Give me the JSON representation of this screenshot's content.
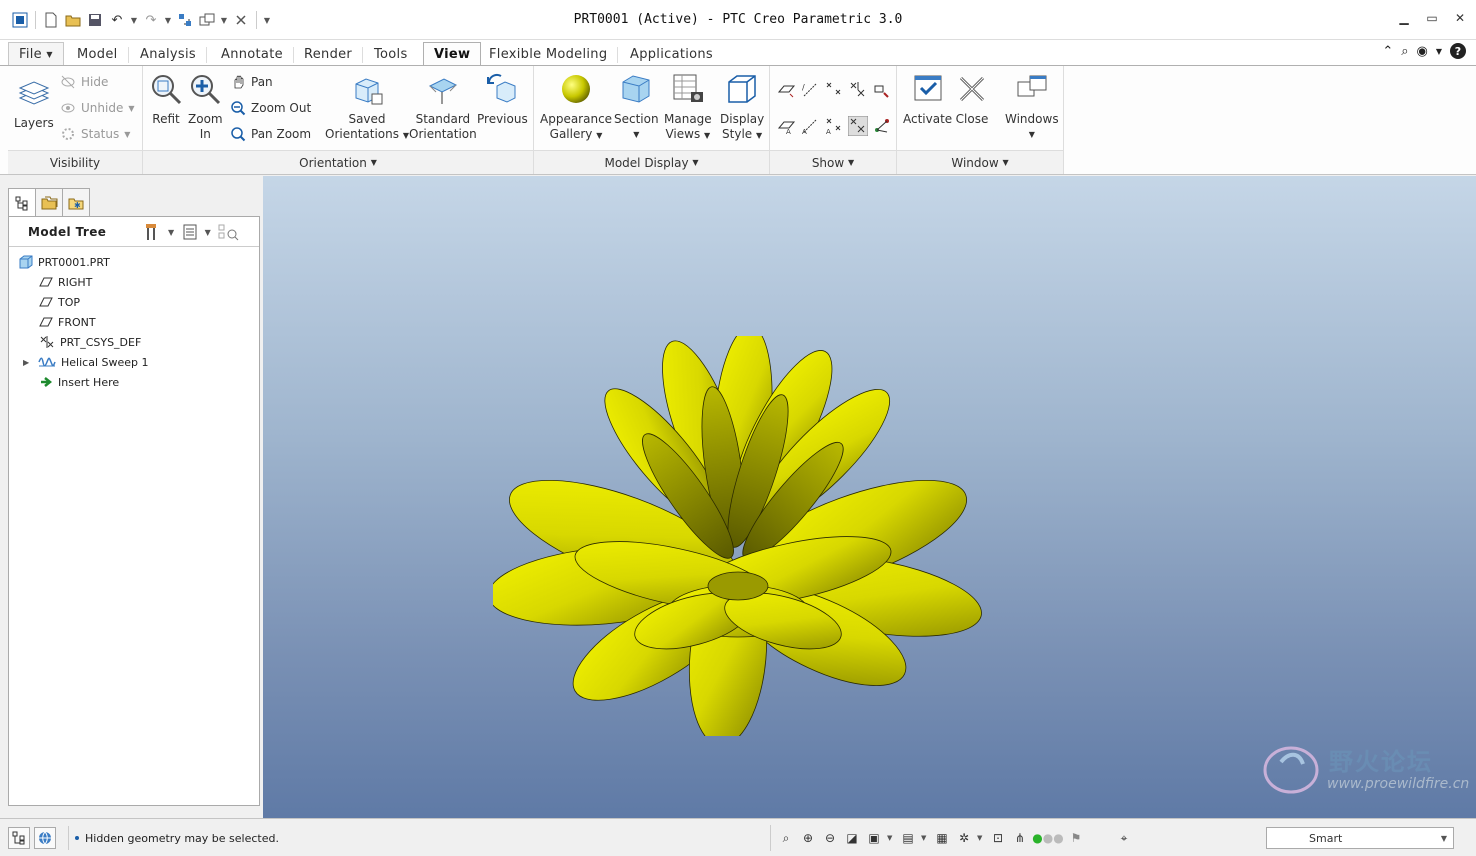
{
  "window": {
    "title": "PRT0001 (Active) - PTC Creo Parametric 3.0"
  },
  "tabs": [
    {
      "label": "File",
      "file": true
    },
    {
      "label": "Model"
    },
    {
      "label": "Analysis"
    },
    {
      "label": "Annotate"
    },
    {
      "label": "Render"
    },
    {
      "label": "Tools"
    },
    {
      "label": "View",
      "active": true
    },
    {
      "label": "Flexible Modeling"
    },
    {
      "label": "Applications"
    }
  ],
  "ribbon": {
    "visibility": {
      "label": "Visibility",
      "layers": "Layers",
      "hide": "Hide",
      "unhide": "Unhide",
      "status": "Status"
    },
    "orientation": {
      "label": "Orientation",
      "refit": "Refit",
      "zoom_in_1": "Zoom",
      "zoom_in_2": "In",
      "pan": "Pan",
      "zoom_out": "Zoom Out",
      "pan_zoom": "Pan Zoom",
      "saved_1": "Saved",
      "saved_2": "Orientations",
      "standard_1": "Standard",
      "standard_2": "Orientation",
      "previous": "Previous"
    },
    "model_display": {
      "label": "Model Display",
      "appearance_1": "Appearance",
      "appearance_2": "Gallery",
      "section": "Section",
      "manage_1": "Manage",
      "manage_2": "Views",
      "display_1": "Display",
      "display_2": "Style"
    },
    "show": {
      "label": "Show"
    },
    "window": {
      "label": "Window",
      "activate": "Activate",
      "close": "Close",
      "windows": "Windows"
    }
  },
  "model_tree": {
    "title": "Model Tree",
    "items": [
      {
        "label": "PRT0001.PRT",
        "icon": "part-icon"
      },
      {
        "label": "RIGHT",
        "icon": "datum-plane-icon"
      },
      {
        "label": "TOP",
        "icon": "datum-plane-icon"
      },
      {
        "label": "FRONT",
        "icon": "datum-plane-icon"
      },
      {
        "label": "PRT_CSYS_DEF",
        "icon": "csys-icon"
      },
      {
        "label": "Helical Sweep 1",
        "icon": "helical-sweep-icon"
      },
      {
        "label": "Insert Here",
        "icon": "insert-arrow-icon"
      }
    ]
  },
  "status": {
    "message": "Hidden geometry may be selected.",
    "filter": "Smart"
  },
  "watermark": {
    "text": "野火论坛",
    "url": "www.proewildfire.cn"
  },
  "colors": {
    "accent": "#1a5ea8",
    "petal": "#e6e600",
    "viewport_top": "#c5d6e7",
    "viewport_bottom": "#5f7aa6"
  }
}
